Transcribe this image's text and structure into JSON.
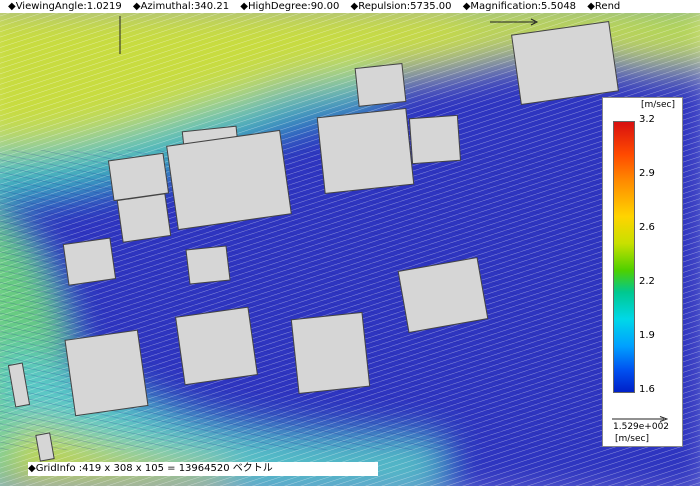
{
  "header": {
    "viewing_angle": "◆ViewingAngle:1.0219",
    "azimuthal": "◆Azimuthal:340.21",
    "high_degree": "◆HighDegree:90.00",
    "repulsion": "◆Repulsion:5735.00",
    "magnification": "◆Magnification:5.5048",
    "render": "◆Rend"
  },
  "footer": {
    "grid_info": "◆GridInfo :419 x 308 x 105 = 13964520 ベクトル"
  },
  "legend": {
    "unit_top": "[m/sec]",
    "ticks": [
      "3.2",
      "2.9",
      "2.6",
      "2.2",
      "1.9",
      "1.6"
    ],
    "reference_value": "1.529e+002",
    "unit_bottom": "[m/sec]",
    "min_value": 1.6,
    "max_value": 3.2
  },
  "colors": {
    "background_flow": "#2a2ab8",
    "fast_flow": "#d8e030",
    "medium_flow": "#30c8c8",
    "building_fill": "#d6d6d6",
    "building_stroke": "#444444"
  }
}
